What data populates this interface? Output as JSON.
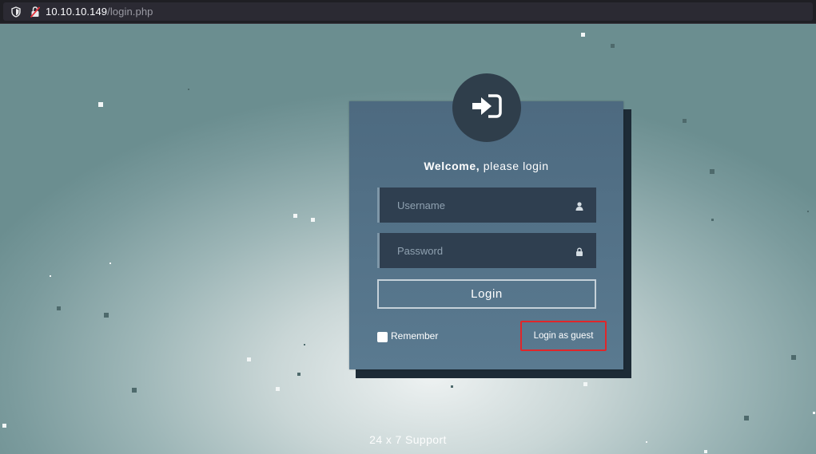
{
  "browser": {
    "url_host": "10.10.10.149",
    "url_path": "/login.php"
  },
  "login": {
    "welcome_bold": "Welcome,",
    "welcome_rest": " please login",
    "username_placeholder": "Username",
    "password_placeholder": "Password",
    "login_label": "Login",
    "remember_label": "Remember",
    "guest_label": "Login as guest"
  },
  "footer": {
    "support": "24 x 7 Support"
  },
  "colors": {
    "card": "#4d6a80",
    "field_bg": "#2f3f50",
    "highlight": "#e0262a",
    "avatar": "#2f3e4b"
  },
  "icons": [
    "shield-icon",
    "insecure-lock-icon",
    "sign-in-icon",
    "user-icon",
    "lock-icon"
  ]
}
